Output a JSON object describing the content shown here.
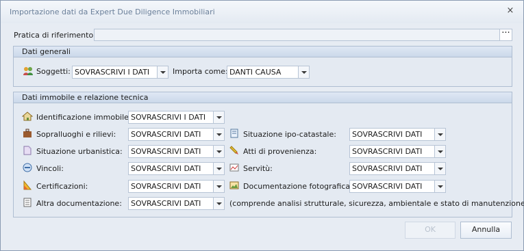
{
  "window": {
    "title": "Importazione dati da Expert Due Diligence Immobiliari",
    "close_icon": "×"
  },
  "pratica": {
    "label": "Pratica di riferimento:",
    "value": "",
    "browse_label": "···"
  },
  "dati_generali": {
    "title": "Dati generali",
    "soggetti_label": "Soggetti:",
    "soggetti_value": "SOVRASCRIVI I DATI",
    "importa_label": "Importa come:",
    "importa_value": "DANTI CAUSA"
  },
  "immobile": {
    "title": "Dati immobile e relazione tecnica",
    "left": [
      {
        "label": "Identificazione immobile:",
        "value": "SOVRASCRIVI I DATI"
      },
      {
        "label": "Sopralluoghi e rilievi:",
        "value": "SOVRASCRIVI DATI"
      },
      {
        "label": "Situazione urbanistica:",
        "value": "SOVRASCRIVI DATI"
      },
      {
        "label": "Vincoli:",
        "value": "SOVRASCRIVI DATI"
      },
      {
        "label": "Certificazioni:",
        "value": "SOVRASCRIVI DATI"
      },
      {
        "label": "Altra documentazione:",
        "value": "SOVRASCRIVI DATI"
      }
    ],
    "right": [
      {
        "label": "Situazione ipo-catastale:",
        "value": "SOVRASCRIVI DATI"
      },
      {
        "label": "Atti di provenienza:",
        "value": "SOVRASCRIVI DATI"
      },
      {
        "label": "Servitù:",
        "value": "SOVRASCRIVI DATI"
      },
      {
        "label": "Documentazione fotografica:",
        "value": "SOVRASCRIVI DATI"
      }
    ],
    "note": "(comprende analisi strutturale, sicurezza, ambientale e stato di manutenzione)"
  },
  "buttons": {
    "ok": "OK",
    "cancel": "Annulla"
  }
}
